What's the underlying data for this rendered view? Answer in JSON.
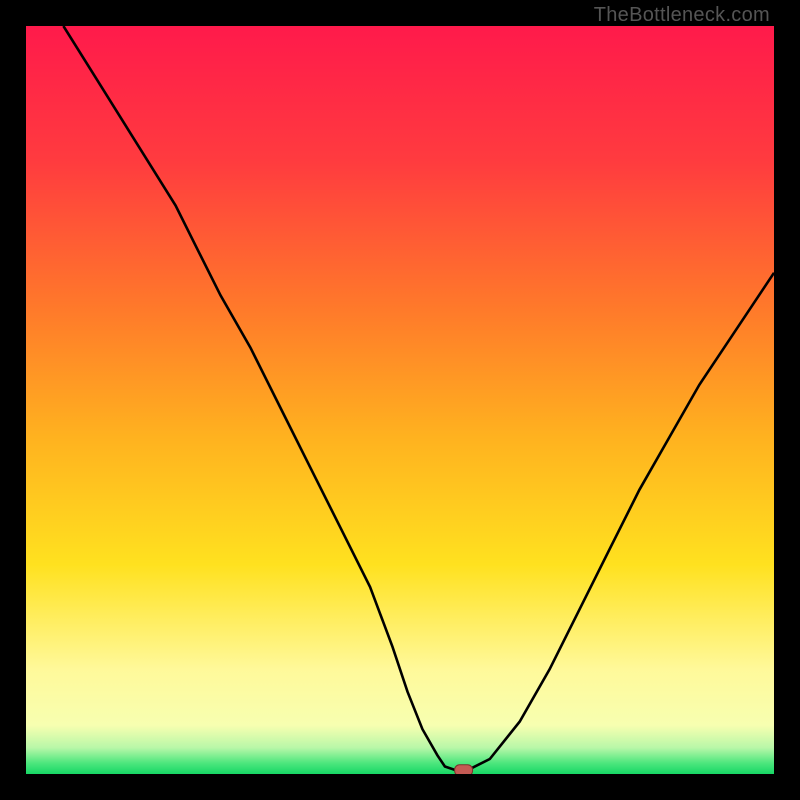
{
  "watermark": "TheBottleneck.com",
  "colors": {
    "frame": "#000000",
    "curve": "#000000",
    "marker_fill": "#c45a54",
    "marker_stroke": "#7a302c",
    "gradient_stops": [
      {
        "offset": 0.0,
        "color": "#ff1a4b"
      },
      {
        "offset": 0.18,
        "color": "#ff3b3f"
      },
      {
        "offset": 0.38,
        "color": "#ff7a2a"
      },
      {
        "offset": 0.55,
        "color": "#ffb21f"
      },
      {
        "offset": 0.72,
        "color": "#ffe11f"
      },
      {
        "offset": 0.86,
        "color": "#fff99a"
      },
      {
        "offset": 0.935,
        "color": "#f7ffb0"
      },
      {
        "offset": 0.965,
        "color": "#b8f7a8"
      },
      {
        "offset": 0.985,
        "color": "#4fe77e"
      },
      {
        "offset": 1.0,
        "color": "#17d765"
      }
    ]
  },
  "chart_data": {
    "type": "line",
    "title": "",
    "xlabel": "",
    "ylabel": "",
    "xlim": [
      0,
      100
    ],
    "ylim": [
      0,
      100
    ],
    "x": [
      5,
      10,
      15,
      20,
      23,
      26,
      30,
      34,
      38,
      42,
      46,
      49,
      51,
      53,
      55,
      56,
      57.5,
      59,
      62,
      66,
      70,
      74,
      78,
      82,
      86,
      90,
      94,
      100
    ],
    "values": [
      100,
      92,
      84,
      76,
      70,
      64,
      57,
      49,
      41,
      33,
      25,
      17,
      11,
      6,
      2.5,
      1,
      0.5,
      0.5,
      2,
      7,
      14,
      22,
      30,
      38,
      45,
      52,
      58,
      67
    ],
    "marker": {
      "x": 58.5,
      "y": 0.5,
      "shape": "rounded-rect"
    }
  }
}
